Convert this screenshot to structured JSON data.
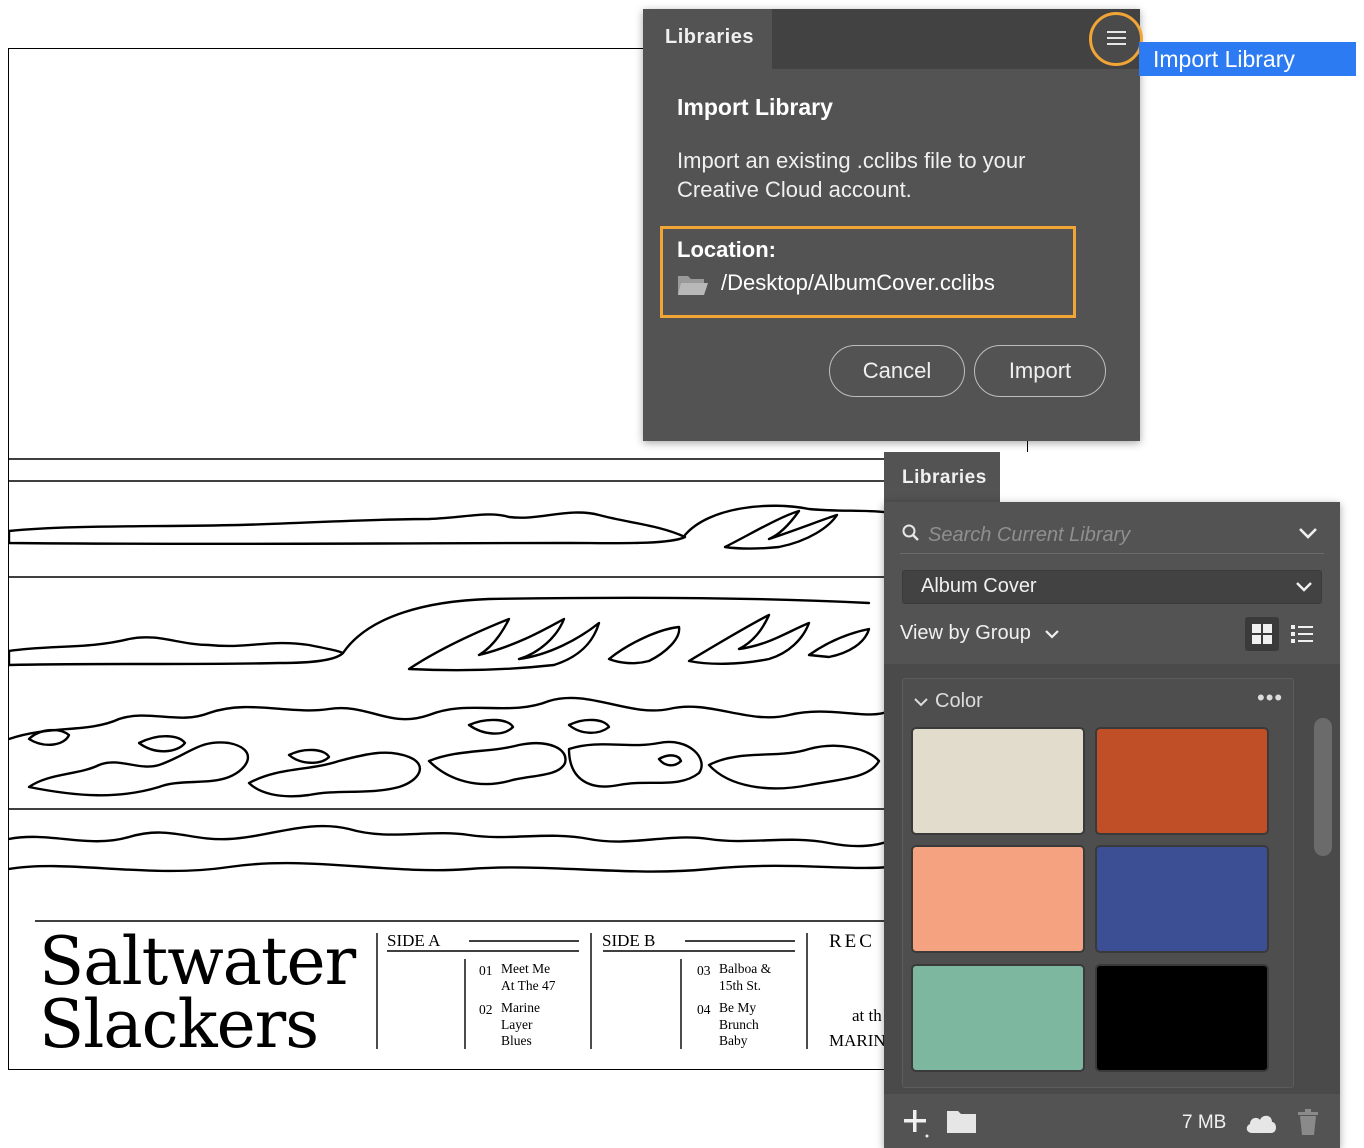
{
  "album": {
    "title_line1": "Saltwater",
    "title_line2": "Slackers",
    "side_a": {
      "heading": "SIDE A",
      "tracks": [
        {
          "num": "01",
          "title": "Meet Me\nAt The 47"
        },
        {
          "num": "02",
          "title": "Marine\nLayer\nBlues"
        }
      ]
    },
    "side_b": {
      "heading": "SIDE B",
      "tracks": [
        {
          "num": "03",
          "title": "Balboa &\n15th St."
        },
        {
          "num": "04",
          "title": "Be My\nBrunch\nBaby"
        }
      ]
    },
    "recorded_heading": "REC",
    "recorded_at": "at th",
    "recorded_place": "MARIN"
  },
  "import_dialog": {
    "tab_label": "Libraries",
    "menu_icon": "hamburger-menu-icon",
    "heading": "Import Library",
    "description": "Import an existing .cclibs file to your Creative Cloud account.",
    "location_label": "Location:",
    "location_path": "/Desktop/AlbumCover.cclibs",
    "cancel_label": "Cancel",
    "import_label": "Import",
    "highlight_color": "#f0a535"
  },
  "tooltip": {
    "text": "Import Library",
    "color": "#2c7bf2"
  },
  "libraries_panel": {
    "tab_label": "Libraries",
    "search_placeholder": "Search Current Library",
    "selected_library": "Album Cover",
    "view_label": "View by Group",
    "group_title": "Color",
    "swatches": [
      {
        "name": "cream",
        "color": "#e1dccb"
      },
      {
        "name": "rust",
        "color": "#c04f28"
      },
      {
        "name": "salmon",
        "color": "#f5a281"
      },
      {
        "name": "navy",
        "color": "#3d4f94"
      },
      {
        "name": "seafoam",
        "color": "#7eb79f"
      },
      {
        "name": "black",
        "color": "#000000"
      }
    ],
    "storage": "7 MB"
  }
}
